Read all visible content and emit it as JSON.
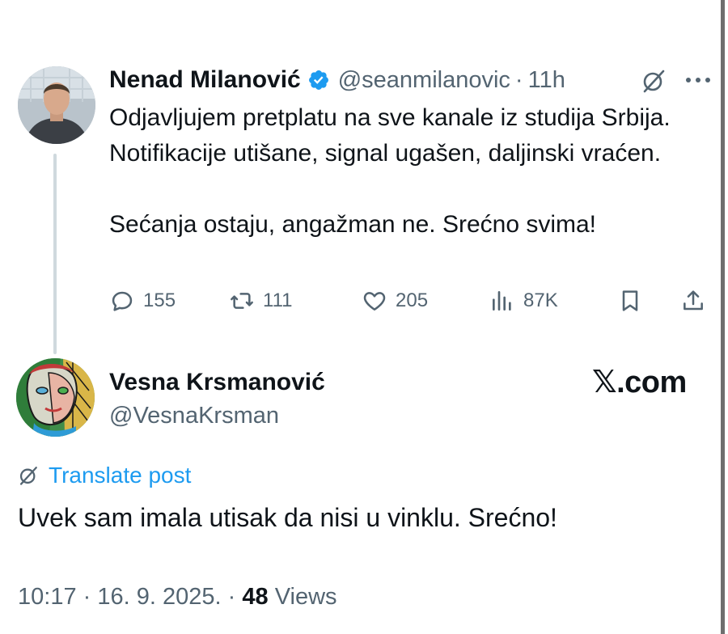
{
  "parent_tweet": {
    "author_name": "Nenad Milanović",
    "handle": "@seanmilanovic",
    "separator": "·",
    "time": "11h",
    "text": "Odjavljujem pretplatu na sve kanale iz studija Srbija. Notifikacije utišane, signal ugašen, daljinski vraćen.\n\nSećanja ostaju, angažman ne. Srećno svima!",
    "actions": {
      "replies": "155",
      "reposts": "111",
      "likes": "205",
      "views": "87K"
    },
    "icons": [
      "verified-badge-icon",
      "grok-icon",
      "more-icon",
      "reply-icon",
      "repost-icon",
      "like-icon",
      "views-icon",
      "bookmark-icon",
      "share-icon"
    ]
  },
  "reply_tweet": {
    "author_name": "Vesna Krsmanović",
    "handle": "@VesnaKrsman",
    "translate_label": "Translate post",
    "text": "Uvek sam imala utisak da nisi u vinklu. Srećno!",
    "time": "10:17",
    "separator": "·",
    "date": "16. 9. 2025.",
    "views_count": "48",
    "views_label": "Views"
  },
  "watermark": "𝕏.com",
  "colors": {
    "text": "#0f1419",
    "secondary": "#536471",
    "accent": "#1d9bf0",
    "thread_line": "#cfd9de"
  }
}
